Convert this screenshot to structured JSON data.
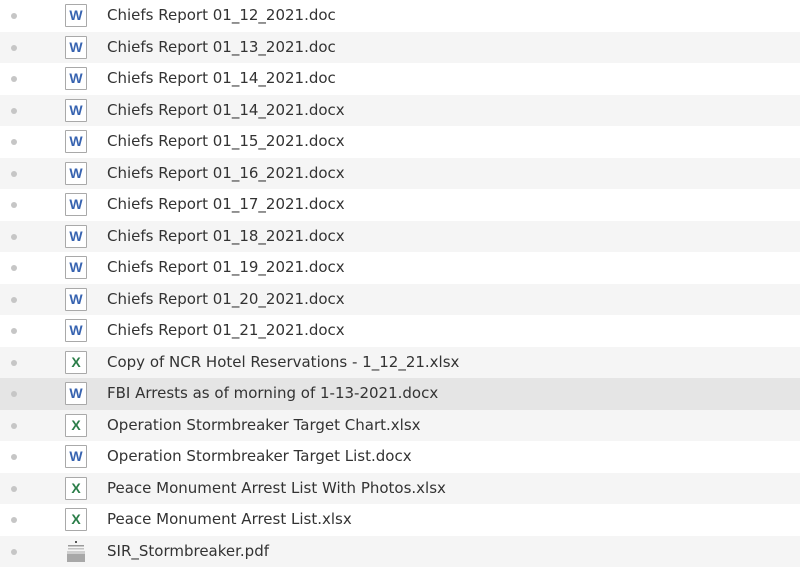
{
  "files": [
    {
      "name": "Chiefs Report 01_12_2021.doc",
      "type": "word-icon"
    },
    {
      "name": "Chiefs Report 01_13_2021.doc",
      "type": "word-icon"
    },
    {
      "name": "Chiefs Report 01_14_2021.doc",
      "type": "word-icon"
    },
    {
      "name": "Chiefs Report 01_14_2021.docx",
      "type": "word-icon"
    },
    {
      "name": "Chiefs Report 01_15_2021.docx",
      "type": "word-icon"
    },
    {
      "name": "Chiefs Report 01_16_2021.docx",
      "type": "word-icon"
    },
    {
      "name": "Chiefs Report 01_17_2021.docx",
      "type": "word-icon"
    },
    {
      "name": "Chiefs Report 01_18_2021.docx",
      "type": "word-icon"
    },
    {
      "name": "Chiefs Report 01_19_2021.docx",
      "type": "word-icon"
    },
    {
      "name": "Chiefs Report 01_20_2021.docx",
      "type": "word-icon"
    },
    {
      "name": "Chiefs Report 01_21_2021.docx",
      "type": "word-icon"
    },
    {
      "name": "Copy of NCR Hotel Reservations - 1_12_21.xlsx",
      "type": "excel-icon"
    },
    {
      "name": "FBI Arrests as of morning of 1-13-2021.docx",
      "type": "word-icon",
      "selected": true
    },
    {
      "name": "Operation Stormbreaker Target Chart.xlsx",
      "type": "excel-icon"
    },
    {
      "name": "Operation Stormbreaker Target List.docx",
      "type": "word-icon"
    },
    {
      "name": "Peace Monument Arrest List With Photos.xlsx",
      "type": "excel-icon"
    },
    {
      "name": "Peace Monument Arrest List.xlsx",
      "type": "excel-icon"
    },
    {
      "name": "SIR_Stormbreaker.pdf",
      "type": "pdf-icon"
    }
  ],
  "icon_glyphs": {
    "word-icon": "W",
    "excel-icon": "X"
  },
  "colors": {
    "word": "#3763b0",
    "excel": "#2a7d48",
    "row_alt": "#f5f5f5",
    "row_selected": "#e5e5e5",
    "text": "#333333"
  }
}
